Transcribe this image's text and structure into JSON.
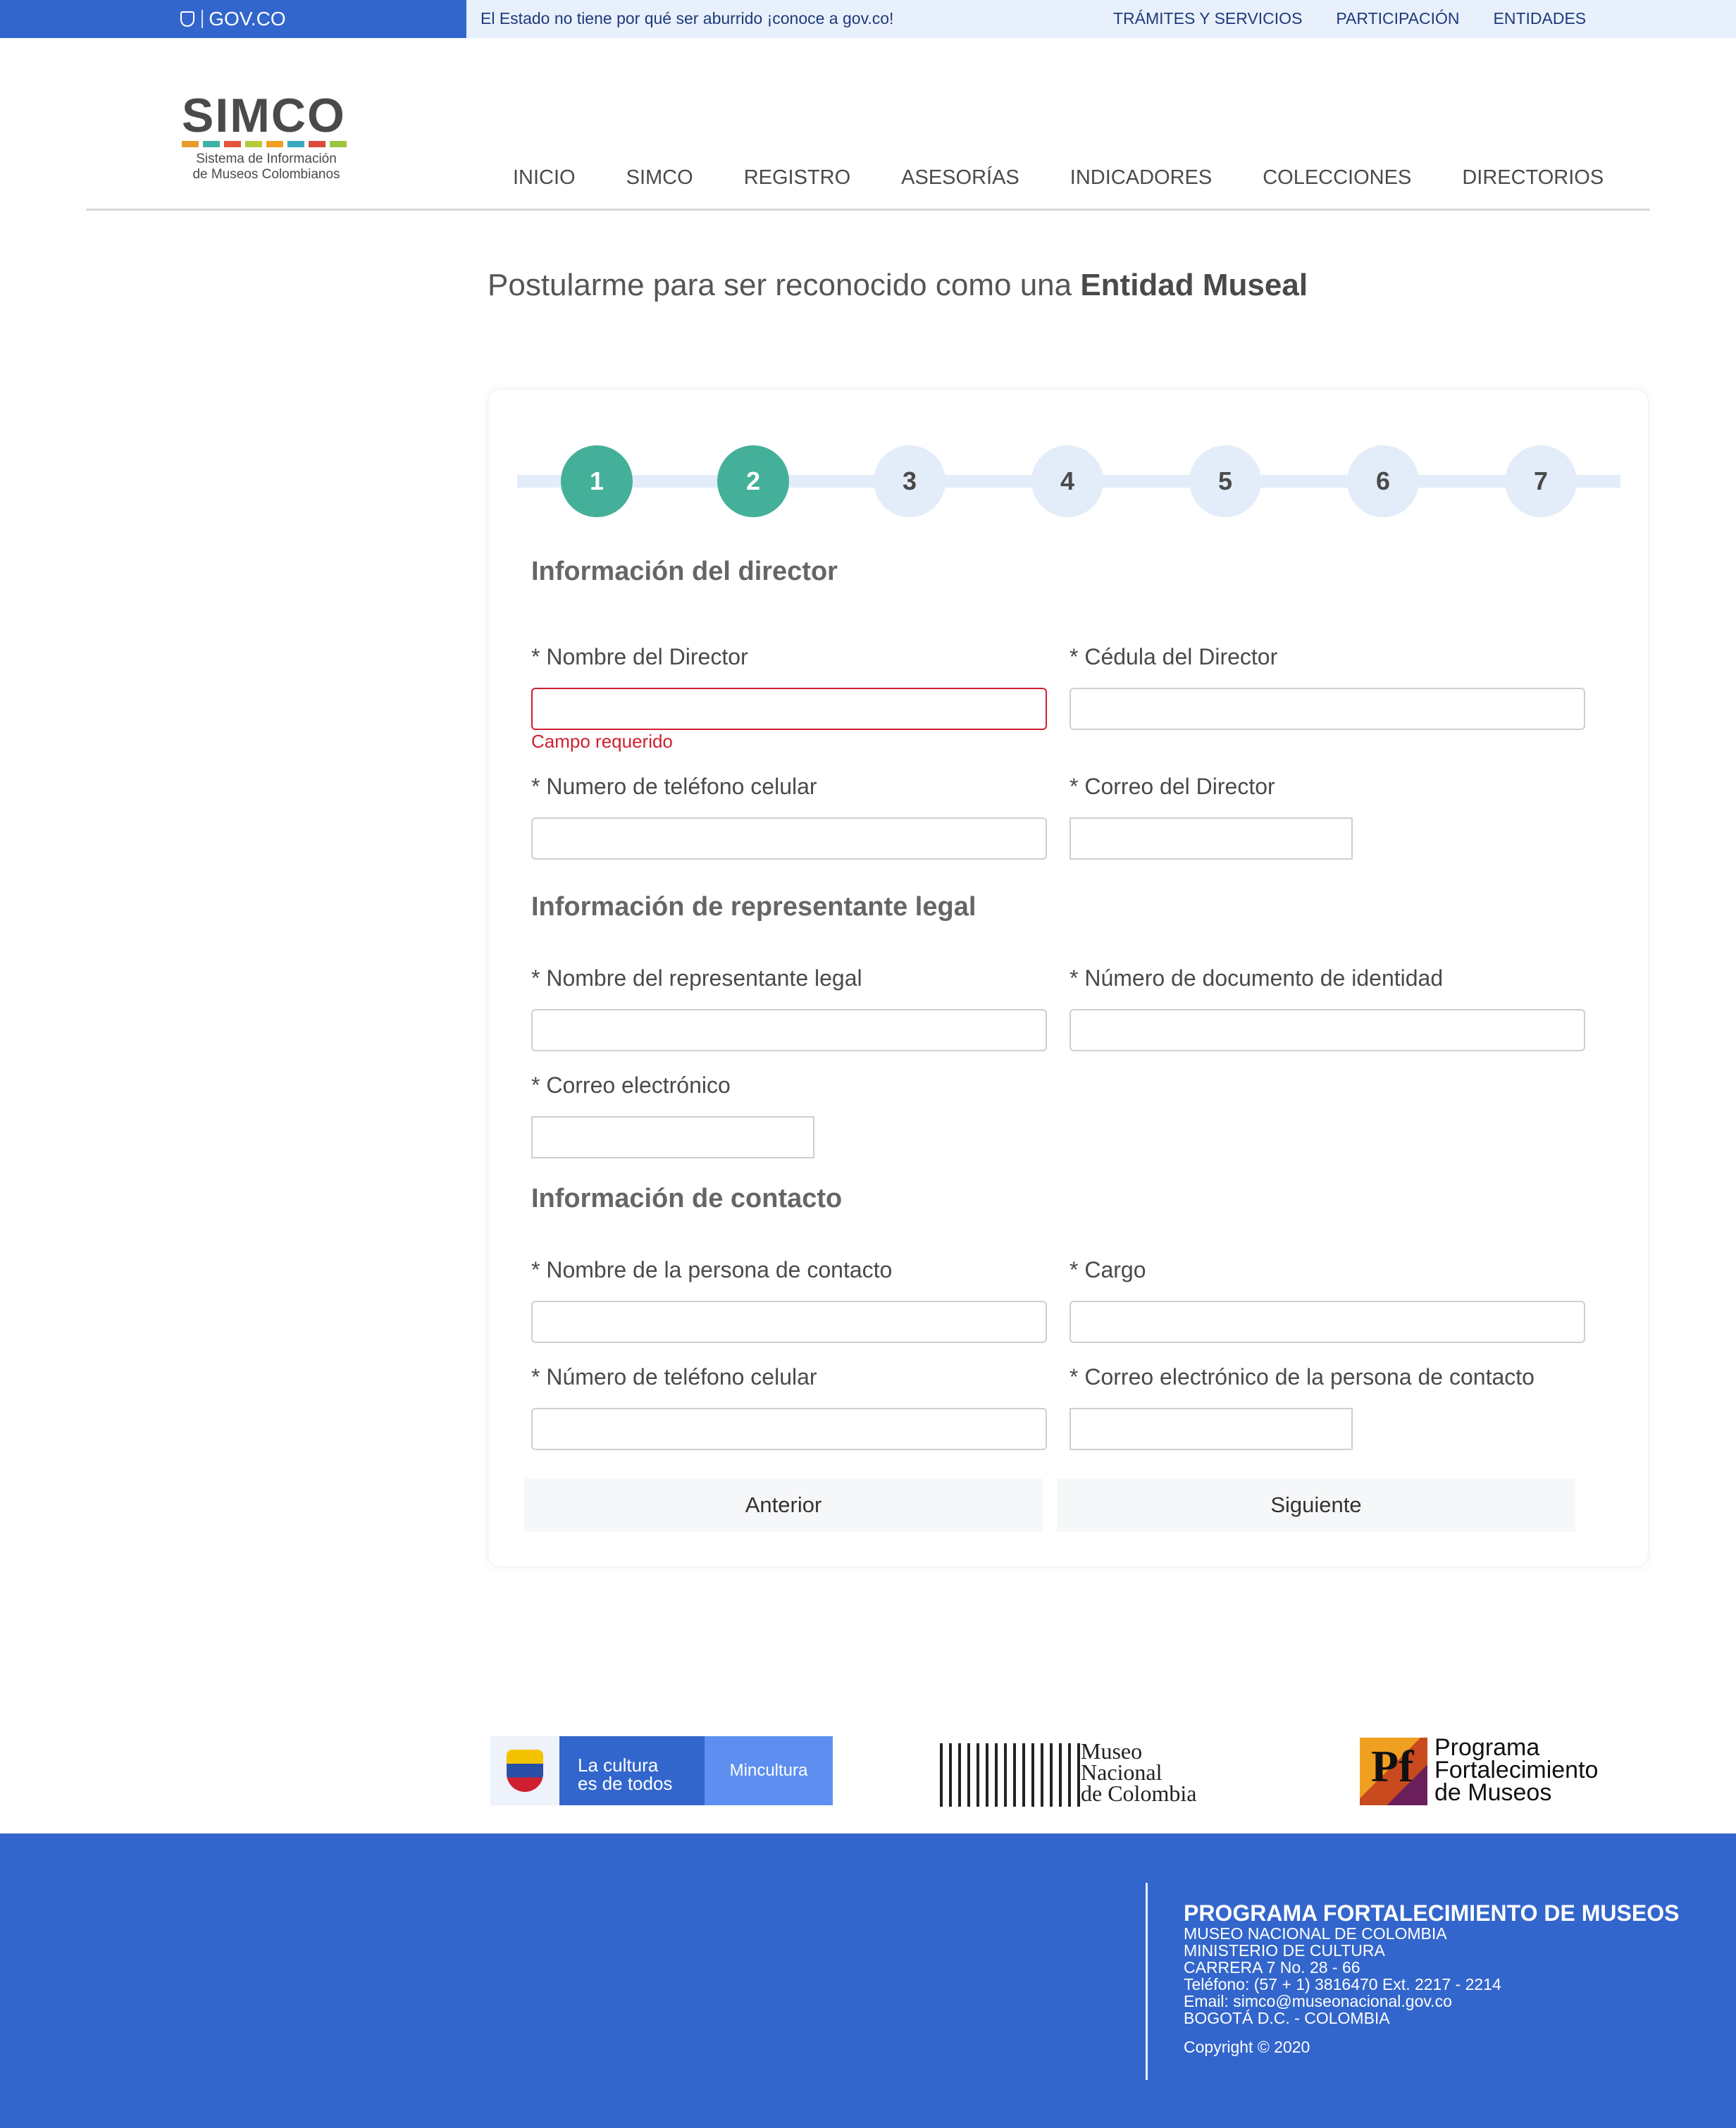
{
  "gov": {
    "brand": "GOV.CO",
    "slogan": "El Estado no tiene por qué ser aburrido ¡conoce a gov.co!",
    "links": [
      "TRÁMITES Y SERVICIOS",
      "PARTICIPACIÓN",
      "ENTIDADES"
    ]
  },
  "logo": {
    "word": "SIMCO",
    "subtitle_1": "Sistema de Información",
    "subtitle_2": "de Museos Colombianos",
    "bar_colors": [
      "#e89a2c",
      "#3fb0a4",
      "#e5533b",
      "#b8c93a",
      "#f0a020",
      "#3aa8c0",
      "#d94a3a",
      "#9bc43f"
    ]
  },
  "nav": [
    "INICIO",
    "SIMCO",
    "REGISTRO",
    "ASESORÍAS",
    "INDICADORES",
    "COLECCIONES",
    "DIRECTORIOS"
  ],
  "title": {
    "prefix": "Postularme para ser reconocido como una ",
    "bold": "Entidad Museal"
  },
  "stepper": {
    "steps": [
      "1",
      "2",
      "3",
      "4",
      "5",
      "6",
      "7"
    ],
    "completed": 2,
    "active_color": "#45b09a"
  },
  "director": {
    "title": "Información del director",
    "name_label": "* Nombre del Director",
    "name_value": "",
    "name_error": "Campo requerido",
    "id_label": "* Cédula del Director",
    "id_value": "",
    "phone_label": "* Numero de teléfono celular",
    "phone_value": "",
    "email_label": "* Correo del Director",
    "email_value": ""
  },
  "legal": {
    "title": "Información de representante legal",
    "name_label": "* Nombre del representante legal",
    "name_value": "",
    "doc_label": "* Número de documento de identidad",
    "doc_value": "",
    "email_label": "* Correo electrónico",
    "email_value": ""
  },
  "contact": {
    "title": "Información de contacto",
    "name_label": "* Nombre de la persona de contacto",
    "name_value": "",
    "role_label": "* Cargo",
    "role_value": "",
    "phone_label": "* Número de teléfono celular",
    "phone_value": "",
    "email_label": "* Correo electrónico de la persona de contacto",
    "email_value": ""
  },
  "buttons": {
    "prev": "Anterior",
    "next": "Siguiente"
  },
  "partners": {
    "minc_line1": "La cultura",
    "minc_line2": "es de todos",
    "minc_name": "Mincultura",
    "mnc_1": "Museo",
    "mnc_2": "Nacional",
    "mnc_3": "de Colombia",
    "pfm_mark": "Pf",
    "pfm_1": "Programa",
    "pfm_2": "Fortalecimiento",
    "pfm_3": "de Museos"
  },
  "footer": {
    "heading": "PROGRAMA FORTALECIMIENTO DE MUSEOS",
    "lines": [
      "MUSEO NACIONAL DE COLOMBIA",
      "MINISTERIO DE CULTURA",
      "CARRERA 7 No. 28 - 66",
      "Teléfono: (57 + 1) 3816470 Ext. 2217 - 2214",
      "Email: simco@museonacional.gov.co",
      "BOGOTÁ D.C. - COLOMBIA"
    ],
    "copyright": "Copyright © 2020"
  }
}
